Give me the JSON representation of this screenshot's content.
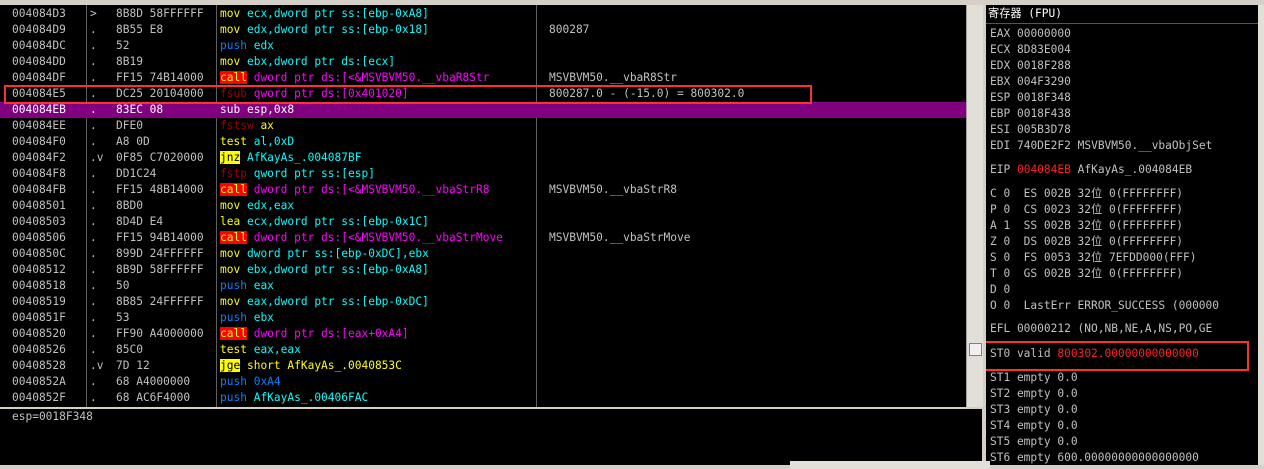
{
  "disasm": {
    "rows": [
      {
        "addr": "004084D3",
        "mark": ">",
        "hex": "8B8D 58FFFFFF",
        "mn": "mov",
        "mnclass": "kw-mov",
        "ops": "ecx,dword ptr ss:[ebp-0xA8]",
        "opsclass": "ops",
        "cmt": ""
      },
      {
        "addr": "004084D9",
        "mark": ".",
        "hex": "8B55 E8",
        "mn": "mov",
        "mnclass": "kw-mov",
        "ops": "edx,dword ptr ss:[ebp-0x18]",
        "opsclass": "ops",
        "cmt": "800287"
      },
      {
        "addr": "004084DC",
        "mark": ".",
        "hex": "52",
        "mn": "push",
        "mnclass": "kw-push",
        "ops": "edx",
        "opsclass": "ops",
        "cmt": ""
      },
      {
        "addr": "004084DD",
        "mark": ".",
        "hex": "8B19",
        "mn": "mov",
        "mnclass": "kw-mov",
        "ops": "ebx,dword ptr ds:[ecx]",
        "opsclass": "ops",
        "cmt": ""
      },
      {
        "addr": "004084DF",
        "mark": ".",
        "hex": "FF15 74B14000",
        "mn": "call",
        "mnclass": "kw-call",
        "ops": "dword ptr ds:[<&MSVBVM50.__vbaR8Str",
        "opsclass": "call-ops",
        "cmt": "MSVBVM50.__vbaR8Str"
      },
      {
        "addr": "004084E5",
        "mark": ".",
        "hex": "DC25 20104000",
        "mn": "fsub",
        "mnclass": "kw-f",
        "ops": "qword ptr ds:[0x401020]",
        "opsclass": "call-ops",
        "cmt": "800287.0 - (-15.0) = 800302.0"
      },
      {
        "addr": "004084EB",
        "mark": ".",
        "hex": "83EC 08",
        "mn": "sub",
        "mnclass": "kw-gen",
        "ops": "esp,0x8",
        "opsclass": "ops",
        "cmt": "",
        "selected": true
      },
      {
        "addr": "004084EE",
        "mark": ".",
        "hex": "DFE0",
        "mn": "fstsw",
        "mnclass": "kw-f",
        "ops": "ax",
        "opsclass": "imm",
        "cmt": ""
      },
      {
        "addr": "004084F0",
        "mark": ".",
        "hex": "A8 0D",
        "mn": "test",
        "mnclass": "kw-mov",
        "ops": "al,0xD",
        "opsclass": "ops",
        "cmt": ""
      },
      {
        "addr": "004084F2",
        "mark": ".v",
        "hex": "0F85 C7020000",
        "mn": "jnz",
        "mnclass": "kw-j",
        "ops": "AfKayAs_.004087BF",
        "opsclass": "ops",
        "cmt": ""
      },
      {
        "addr": "004084F8",
        "mark": ".",
        "hex": "DD1C24",
        "mn": "fstp",
        "mnclass": "kw-f",
        "ops": "qword ptr ss:[esp]",
        "opsclass": "ops",
        "cmt": ""
      },
      {
        "addr": "004084FB",
        "mark": ".",
        "hex": "FF15 48B14000",
        "mn": "call",
        "mnclass": "kw-call",
        "ops": "dword ptr ds:[<&MSVBVM50.__vbaStrR8",
        "opsclass": "call-ops",
        "cmt": "MSVBVM50.__vbaStrR8"
      },
      {
        "addr": "00408501",
        "mark": ".",
        "hex": "8BD0",
        "mn": "mov",
        "mnclass": "kw-mov",
        "ops": "edx,eax",
        "opsclass": "ops",
        "cmt": ""
      },
      {
        "addr": "00408503",
        "mark": ".",
        "hex": "8D4D E4",
        "mn": "lea",
        "mnclass": "kw-mov",
        "ops": "ecx,dword ptr ss:[ebp-0x1C]",
        "opsclass": "ops",
        "cmt": ""
      },
      {
        "addr": "00408506",
        "mark": ".",
        "hex": "FF15 94B14000",
        "mn": "call",
        "mnclass": "kw-call",
        "ops": "dword ptr ds:[<&MSVBVM50.__vbaStrMove",
        "opsclass": "call-ops",
        "cmt": "MSVBVM50.__vbaStrMove"
      },
      {
        "addr": "0040850C",
        "mark": ".",
        "hex": "899D 24FFFFFF",
        "mn": "mov",
        "mnclass": "kw-mov",
        "ops": "dword ptr ss:[ebp-0xDC],ebx",
        "opsclass": "ops",
        "cmt": ""
      },
      {
        "addr": "00408512",
        "mark": ".",
        "hex": "8B9D 58FFFFFF",
        "mn": "mov",
        "mnclass": "kw-mov",
        "ops": "ebx,dword ptr ss:[ebp-0xA8]",
        "opsclass": "ops",
        "cmt": ""
      },
      {
        "addr": "00408518",
        "mark": ".",
        "hex": "50",
        "mn": "push",
        "mnclass": "kw-push",
        "ops": "eax",
        "opsclass": "ops",
        "cmt": ""
      },
      {
        "addr": "00408519",
        "mark": ".",
        "hex": "8B85 24FFFFFF",
        "mn": "mov",
        "mnclass": "kw-mov",
        "ops": "eax,dword ptr ss:[ebp-0xDC]",
        "opsclass": "ops",
        "cmt": ""
      },
      {
        "addr": "0040851F",
        "mark": ".",
        "hex": "53",
        "mn": "push",
        "mnclass": "kw-push",
        "ops": "ebx",
        "opsclass": "ops",
        "cmt": ""
      },
      {
        "addr": "00408520",
        "mark": ".",
        "hex": "FF90 A4000000",
        "mn": "call",
        "mnclass": "kw-call",
        "ops": "dword ptr ds:[eax+0xA4]",
        "opsclass": "call-ops",
        "cmt": ""
      },
      {
        "addr": "00408526",
        "mark": ".",
        "hex": "85C0",
        "mn": "test",
        "mnclass": "kw-mov",
        "ops": "eax,eax",
        "opsclass": "ops",
        "cmt": ""
      },
      {
        "addr": "00408528",
        "mark": ".v",
        "hex": "7D 12",
        "mn": "jge",
        "mnclass": "kw-j",
        "ops": "short AfKayAs_.0040853C",
        "opsclass": "imm",
        "cmt": ""
      },
      {
        "addr": "0040852A",
        "mark": ".",
        "hex": "68 A4000000",
        "mn": "push",
        "mnclass": "kw-push",
        "ops": "0xA4",
        "opsclass": "kw-push",
        "cmt": ""
      },
      {
        "addr": "0040852F",
        "mark": ".",
        "hex": "68 AC6F4000",
        "mn": "push",
        "mnclass": "kw-push",
        "ops": "AfKayAs_.00406FAC",
        "opsclass": "ops",
        "cmt": ""
      }
    ]
  },
  "info": {
    "text": "esp=0018F348"
  },
  "registers": {
    "title": "寄存器 (FPU)",
    "general": [
      {
        "name": "EAX",
        "value": "00000000",
        "extra": ""
      },
      {
        "name": "ECX",
        "value": "8D83E004",
        "extra": ""
      },
      {
        "name": "EDX",
        "value": "0018F288",
        "extra": ""
      },
      {
        "name": "EBX",
        "value": "004F3290",
        "extra": ""
      },
      {
        "name": "ESP",
        "value": "0018F348",
        "extra": ""
      },
      {
        "name": "EBP",
        "value": "0018F438",
        "extra": ""
      },
      {
        "name": "ESI",
        "value": "005B3D78",
        "extra": ""
      },
      {
        "name": "EDI",
        "value": "740DE2F2",
        "extra": "MSVBVM50.__vbaObjSet"
      }
    ],
    "eip": {
      "name": "EIP",
      "value": "004084EB",
      "extra": "AfKayAs_.004084EB"
    },
    "flags": [
      "C 0  ES 002B 32位 0(FFFFFFFF)",
      "P 0  CS 0023 32位 0(FFFFFFFF)",
      "A 1  SS 002B 32位 0(FFFFFFFF)",
      "Z 0  DS 002B 32位 0(FFFFFFFF)",
      "S 0  FS 0053 32位 7EFDD000(FFF)",
      "T 0  GS 002B 32位 0(FFFFFFFF)",
      "D 0",
      "O 0  LastErr ERROR_SUCCESS (000000"
    ],
    "efl": "EFL 00000212 (NO,NB,NE,A,NS,PO,GE",
    "st0": {
      "label": "ST0 valid",
      "value": "800302.00000000000000"
    },
    "fpu": [
      "ST1 empty 0.0",
      "ST2 empty 0.0",
      "ST3 empty 0.0",
      "ST4 empty 0.0",
      "ST5 empty 0.0",
      "ST6 empty 600.00000000000000000",
      "ST7 empty 0.0"
    ]
  }
}
